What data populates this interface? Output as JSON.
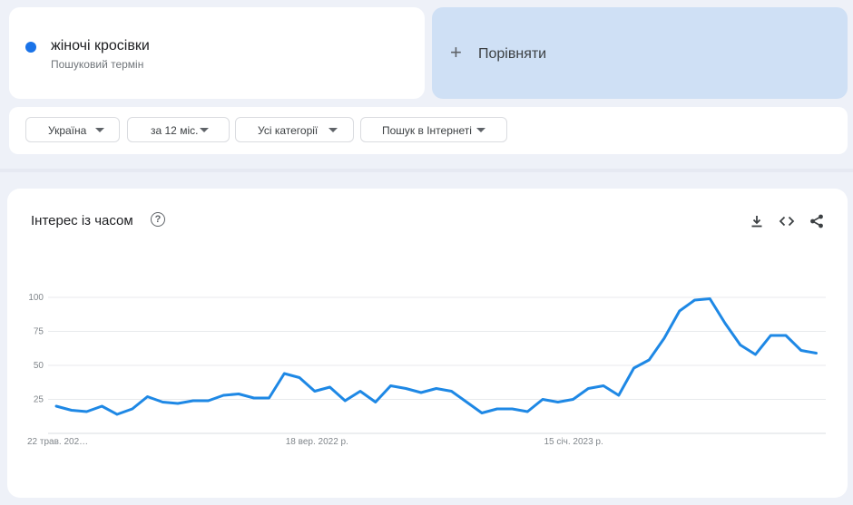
{
  "search": {
    "term": "жіночі кросівки",
    "term_subtitle": "Пошуковий термін",
    "term_color": "#1a73e8",
    "compare_label": "Порівняти",
    "compare_icon": "plus-icon"
  },
  "filters": {
    "region": "Україна",
    "period": "за 12 міс.",
    "category": "Усі категорії",
    "search_type": "Пошук в Інтернеті"
  },
  "chart_panel": {
    "title": "Інтерес із часом",
    "help_icon": "help-circle-icon",
    "actions": [
      "download-icon",
      "embed-code-icon",
      "share-icon"
    ]
  },
  "chart_data": {
    "type": "line",
    "title": "Інтерес із часом",
    "xlabel": "",
    "ylabel": "",
    "ylim": [
      0,
      100
    ],
    "yticks": [
      25,
      50,
      75,
      100
    ],
    "xtick_labels": [
      "22 трав. 202…",
      "18 вер. 2022 р.",
      "15 січ. 2023 р."
    ],
    "xtick_positions": [
      0,
      17,
      34
    ],
    "grid": true,
    "legend": "none",
    "series": [
      {
        "name": "жіночі кросівки",
        "color": "#1e88e5",
        "x_index": [
          0,
          1,
          2,
          3,
          4,
          5,
          6,
          7,
          8,
          9,
          10,
          11,
          12,
          13,
          14,
          15,
          16,
          17,
          18,
          19,
          20,
          21,
          22,
          23,
          24,
          25,
          26,
          27,
          28,
          29,
          30,
          31,
          32,
          33,
          34,
          35,
          36,
          37,
          38,
          39,
          40,
          41,
          42,
          43,
          44,
          45,
          46,
          47,
          48,
          49,
          50,
          51,
          52
        ],
        "values": [
          20,
          17,
          16,
          20,
          14,
          18,
          27,
          23,
          22,
          24,
          24,
          28,
          29,
          26,
          26,
          44,
          41,
          31,
          34,
          24,
          31,
          23,
          35,
          33,
          30,
          33,
          31,
          23,
          15,
          18,
          18,
          16,
          25,
          23,
          25,
          33,
          35,
          28,
          48,
          54,
          70,
          90,
          98,
          99,
          81,
          65,
          58,
          72,
          72,
          61,
          59
        ]
      }
    ]
  }
}
